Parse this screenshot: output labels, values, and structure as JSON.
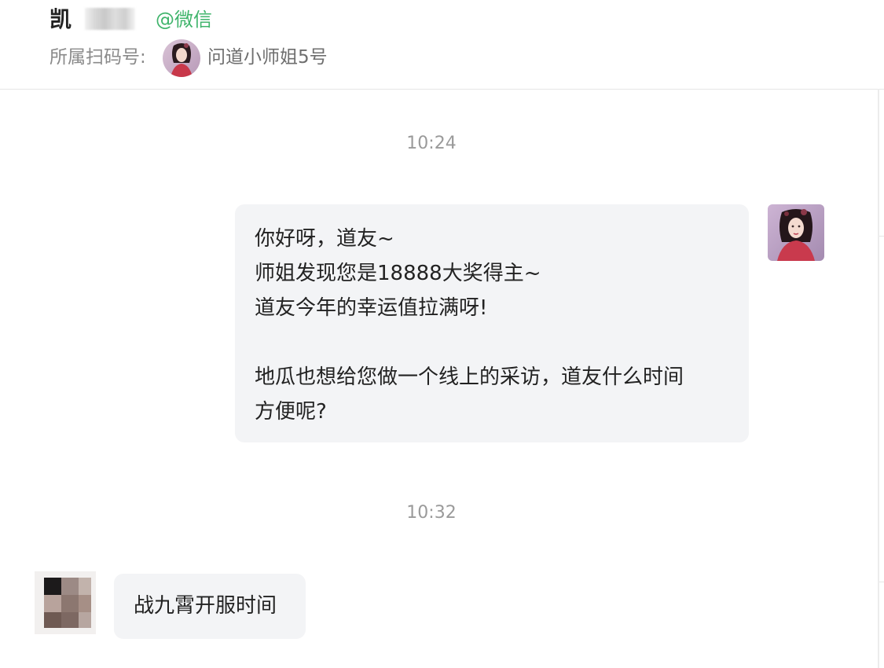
{
  "header": {
    "contact_name": "凯",
    "source_tag": "@微信",
    "scan_label": "所属扫码号:",
    "scan_account": "问道小师姐5号"
  },
  "chat": {
    "timestamps": [
      "10:24",
      "10:32"
    ],
    "outgoing": {
      "lines": [
        "你好呀，道友~",
        "师姐发现您是18888大奖得主~",
        "道友今年的幸运值拉满呀!",
        "",
        "地瓜也想给您做一个线上的采访，道友什么时间",
        "方便呢?"
      ]
    },
    "incoming": {
      "text": "战九霄开服时间"
    }
  },
  "colors": {
    "accent_green": "#3fb46b",
    "bubble_bg": "#f3f4f6",
    "muted_text": "#8a8a8a"
  }
}
